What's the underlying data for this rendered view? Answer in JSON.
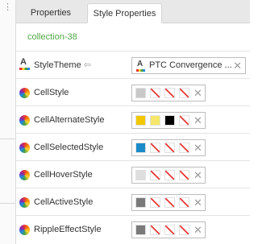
{
  "tabs": {
    "properties": "Properties",
    "style_properties": "Style Properties"
  },
  "collection_name": "collection-38",
  "style_theme": {
    "label": "StyleTheme",
    "value": "PTC Convergence ...",
    "clear": "✕"
  },
  "rows": [
    {
      "label": "CellStyle",
      "swatches": [
        "#c8c8c8",
        "none",
        "none",
        "none"
      ]
    },
    {
      "label": "CellAlternateStyle",
      "swatches": [
        "#f2c800",
        "#f5e76a",
        "#000000",
        "none"
      ]
    },
    {
      "label": "CellSelectedStyle",
      "swatches": [
        "#1a8bc8",
        "none",
        "none",
        "none"
      ]
    },
    {
      "label": "CellHoverStyle",
      "swatches": [
        "#dedede",
        "none",
        "none",
        "none"
      ]
    },
    {
      "label": "CellActiveStyle",
      "swatches": [
        "#7a7a7a",
        "none",
        "none",
        "none"
      ]
    },
    {
      "label": "RippleEffectStyle",
      "swatches": [
        "#7a7a7a",
        "none",
        "none",
        "none"
      ]
    }
  ],
  "icons": {
    "row_icon": "color-wheel-icon",
    "theme_icon": "style-theme-icon",
    "link": "link-arrow-icon",
    "clear": "clear-x-icon"
  }
}
